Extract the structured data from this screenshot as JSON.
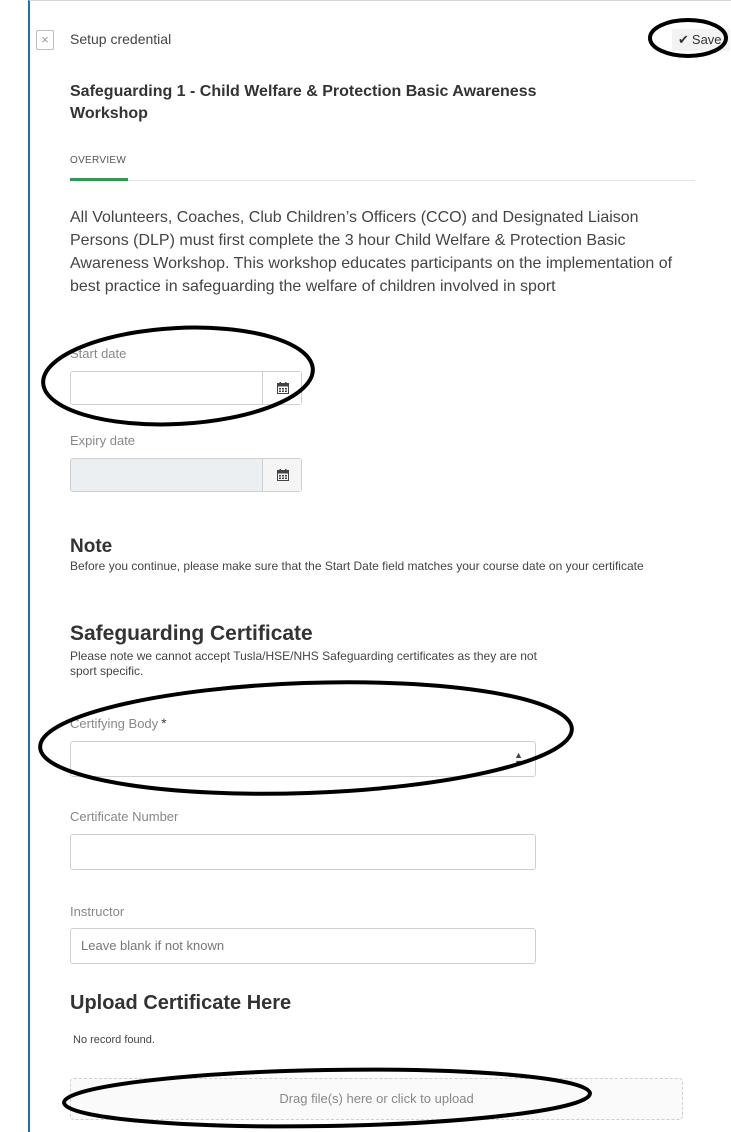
{
  "header": {
    "close_icon": "close-icon",
    "title": "Setup credential",
    "save_label": "Save",
    "save_icon": "check-icon"
  },
  "course": {
    "title": "Safeguarding 1 - Child Welfare & Protection Basic Awareness Workshop"
  },
  "tabs": [
    {
      "label": "OVERVIEW",
      "active": true
    }
  ],
  "overview": {
    "text": "All Volunteers, Coaches, Club Children’s Officers (CCO) and Designated Liaison Persons (DLP) must first complete the 3 hour Child Welfare & Protection Basic Awareness Workshop. This workshop educates participants on the implementation of best practice in safeguarding the welfare of children involved in sport"
  },
  "form": {
    "start_date": {
      "label": "Start date",
      "value": "",
      "icon": "calendar-icon"
    },
    "expiry_date": {
      "label": "Expiry date",
      "value": "",
      "disabled": true,
      "icon": "calendar-icon"
    }
  },
  "note": {
    "title": "Note",
    "text": "Before you continue, please make sure that the Start Date field matches your course date on your certificate"
  },
  "certificate": {
    "title": "Safeguarding Certificate",
    "text": "Please note we cannot accept Tusla/HSE/NHS Safeguarding certificates as they are not sport specific.",
    "certifying_body": {
      "label": "Certifying Body",
      "required_mark": "*",
      "value": ""
    },
    "certificate_number": {
      "label": "Certificate Number",
      "value": ""
    },
    "instructor": {
      "label": "Instructor",
      "placeholder": "Leave blank if not known",
      "value": ""
    }
  },
  "upload": {
    "title": "Upload Certificate Here",
    "empty_text": "No record found.",
    "dropzone_text": "Drag file(s) here or click to upload"
  },
  "colors": {
    "accent_border": "#1f6fb5",
    "tab_active": "#2e9a54",
    "annotation": "#000000"
  }
}
